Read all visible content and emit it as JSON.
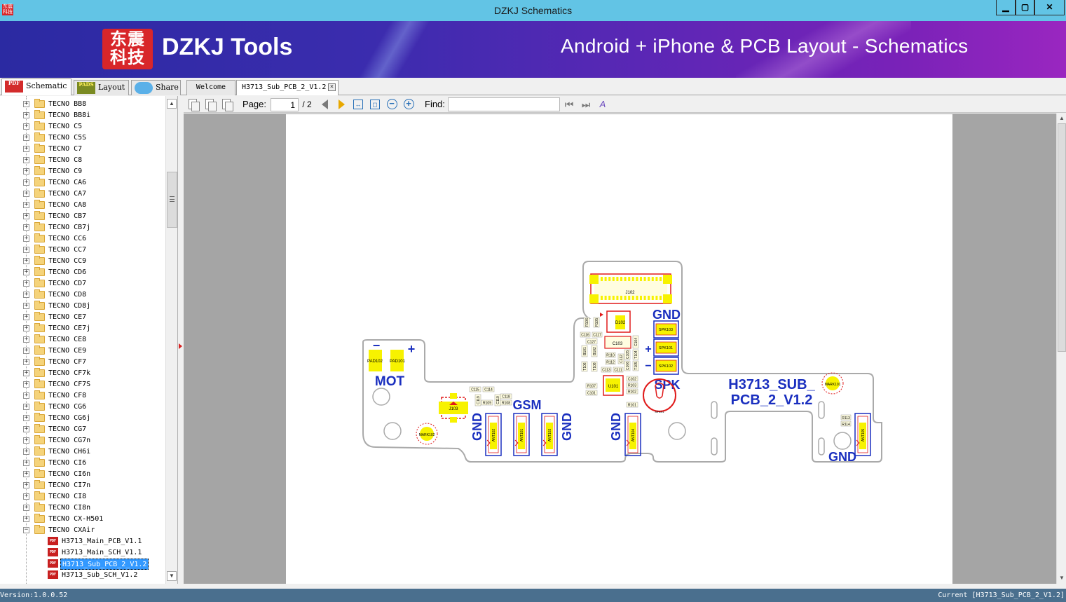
{
  "window": {
    "title": "DZKJ Schematics",
    "app_icon_text": "东震科技",
    "minimize": "▁",
    "maximize": "▢",
    "close": "✕"
  },
  "banner": {
    "logo_text": "东震科技",
    "brand": "DZKJ Tools",
    "tagline": "Android + iPhone & PCB Layout - Schematics"
  },
  "side_tabs": [
    {
      "label": "Schematic",
      "icon": "pdf-icon",
      "icon_text": "PDF"
    },
    {
      "label": "Layout",
      "icon": "pads-icon",
      "icon_text": "PADS"
    },
    {
      "label": "Share",
      "icon": "cloud-share-icon",
      "icon_text": ""
    }
  ],
  "doc_tabs": [
    {
      "label": "Welcome"
    },
    {
      "label": "H3713_Sub_PCB_2_V1.2",
      "active": true
    }
  ],
  "tree": {
    "folders": [
      "TECNO BB8",
      "TECNO BB8i",
      "TECNO C5",
      "TECNO C5S",
      "TECNO C7",
      "TECNO C8",
      "TECNO C9",
      "TECNO CA6",
      "TECNO CA7",
      "TECNO CA8",
      "TECNO CB7",
      "TECNO CB7j",
      "TECNO CC6",
      "TECNO CC7",
      "TECNO CC9",
      "TECNO CD6",
      "TECNO CD7",
      "TECNO CD8",
      "TECNO CD8j",
      "TECNO CE7",
      "TECNO CE7j",
      "TECNO CE8",
      "TECNO CE9",
      "TECNO CF7",
      "TECNO CF7k",
      "TECNO CF7S",
      "TECNO CF8",
      "TECNO CG6",
      "TECNO CG6j",
      "TECNO CG7",
      "TECNO CG7n",
      "TECNO CH6i",
      "TECNO CI6",
      "TECNO CI6n",
      "TECNO CI7n",
      "TECNO CI8",
      "TECNO CI8n",
      "TECNO CX-H501"
    ],
    "expanded_folder": "TECNO CXAir",
    "files": [
      "H3713_Main_PCB_V1.1",
      "H3713_Main_SCH_V1.1",
      "H3713_Sub_PCB_2_V1.2",
      "H3713_Sub_SCH_V1.2"
    ],
    "selected_file": "H3713_Sub_PCB_2_V1.2",
    "expand_symbol": "+",
    "collapse_symbol": "−",
    "file_icon_text": "PDF"
  },
  "toolbar": {
    "page_label": "Page:",
    "page_value": "1",
    "page_total": "/ 2",
    "find_label": "Find:",
    "find_value": ""
  },
  "board": {
    "title_line1": "H3713_SUB_",
    "title_line2": "PCB_2_V1.2",
    "labels": {
      "mot": "MOT",
      "gsm": "GSM",
      "spk": "SPK",
      "gnd": "GND",
      "minus": "−",
      "plus": "+"
    },
    "components": {
      "j102": "J102",
      "d102": "D102",
      "c103": "C103",
      "u101": "U101",
      "j103": "J103",
      "spk103": "SPK103",
      "spk101": "SPK101",
      "spk102": "SPK102",
      "pad102": "PAD102",
      "pad101": "PAD101",
      "mark101": "MARK101",
      "mark102": "MARK102",
      "ant101": "ANT101",
      "ant102": "ANT102",
      "ant103": "ANT103",
      "ant104": "ANT104",
      "ant105": "ANT105",
      "r113": "R113",
      "r114": "R114",
      "r101": "R101",
      "r102": "R102",
      "r103": "R103",
      "r107": "R107",
      "c101": "C101",
      "c102": "C102",
      "c115": "C115",
      "c114": "C114",
      "c118": "C118",
      "r109": "R109",
      "r108": "R108",
      "c119": "C119",
      "c110": "C110",
      "r106": "R106",
      "r105": "R105",
      "c116": "C116",
      "c117": "C117",
      "c127": "C127",
      "b101": "B101",
      "b102": "B102",
      "r110": "R110",
      "r112": "R112",
      "c112": "C112",
      "c104": "C104",
      "c105": "C105",
      "c113": "C113",
      "c111": "C111",
      "t104": "T104",
      "t105": "T105",
      "t106": "T106",
      "t108": "T108",
      "t101": "T101",
      "c106": "C106",
      "mh101": "MH101"
    }
  },
  "status": {
    "version": "Version:1.0.0.52",
    "current": "Current [H3713_Sub_PCB_2_V1.2]"
  },
  "colors": {
    "titlebar": "#62c4e5",
    "banner_start": "#2b2aa2",
    "banner_end": "#9a26c0",
    "silk_blue": "#1a2fbf",
    "pad_yellow": "#f7f200",
    "ref_red": "#e01a1a",
    "status_bar": "#4a6f8e",
    "selection": "#3399ff"
  }
}
